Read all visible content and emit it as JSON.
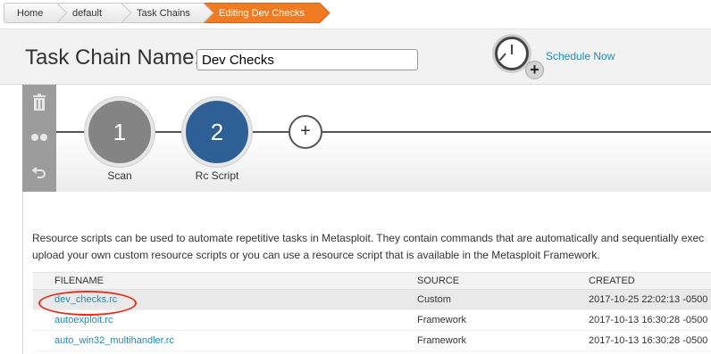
{
  "breadcrumb": [
    "Home",
    "default",
    "Task Chains",
    "Editing Dev Checks"
  ],
  "header": {
    "title_label": "Task Chain Name:",
    "name_value": "Dev Checks",
    "schedule_label": "Schedule Now",
    "clock_plus": "+"
  },
  "toolbar": {
    "delete_icon": "trash-icon",
    "clone_icon": "clone-icon",
    "undo_icon": "undo-icon"
  },
  "steps": [
    {
      "number": "1",
      "label": "Scan",
      "color": "#848484"
    },
    {
      "number": "2",
      "label": "Rc Script",
      "color": "#2e6096"
    }
  ],
  "add_step_label": "+",
  "description": [
    "Resource scripts can be used to automate repetitive tasks in Metasploit. They contain commands that are automatically and sequentially exec",
    "upload your own custom resource scripts or you can use a resource script that is available in the Metasploit Framework."
  ],
  "table": {
    "columns": [
      "FILENAME",
      "SOURCE",
      "CREATED"
    ],
    "rows": [
      {
        "filename": "dev_checks.rc",
        "source": "Custom",
        "created": "2017-10-25 22:02:13 -0500",
        "selected": true
      },
      {
        "filename": "autoexploit.rc",
        "source": "Framework",
        "created": "2017-10-13 16:30:28 -0500",
        "selected": false
      },
      {
        "filename": "auto_win32_multihandler.rc",
        "source": "Framework",
        "created": "2017-10-13 16:30:28 -0500",
        "selected": false
      }
    ]
  },
  "colors": {
    "accent_orange": "#f07b22",
    "step_active": "#2e6096",
    "link": "#1a8fbf",
    "highlight_circle": "#e2301c"
  }
}
